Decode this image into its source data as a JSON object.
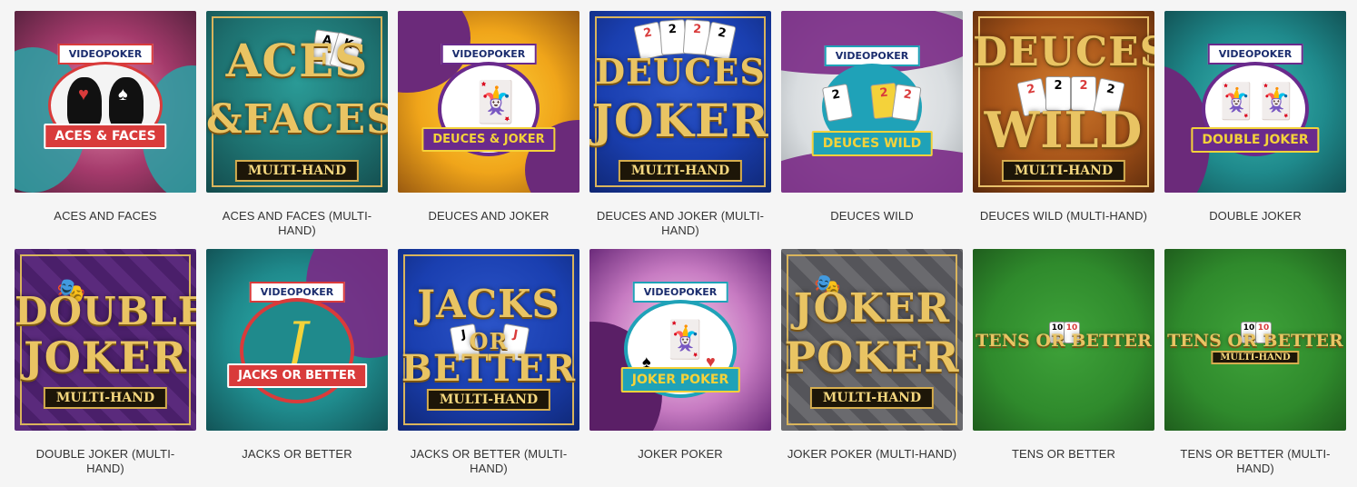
{
  "games": [
    {
      "title": "ACES AND FACES",
      "art": {
        "videopoker": "VIDEOPOKER",
        "ribbon": "ACES & FACES"
      }
    },
    {
      "title": "ACES AND FACES (MULTI-HAND)",
      "art": {
        "line1": "ACES",
        "line2": "&FACES",
        "band": "MULTI-HAND"
      }
    },
    {
      "title": "DEUCES AND JOKER",
      "art": {
        "videopoker": "VIDEOPOKER",
        "ribbon": "DEUCES & JOKER"
      }
    },
    {
      "title": "DEUCES AND JOKER (MULTI-HAND)",
      "art": {
        "line1": "DEUCES",
        "line2": "JOKER",
        "band": "MULTI-HAND"
      }
    },
    {
      "title": "DEUCES WILD",
      "art": {
        "videopoker": "VIDEOPOKER",
        "ribbon": "DEUCES WILD"
      }
    },
    {
      "title": "DEUCES WILD (MULTI-HAND)",
      "art": {
        "line1": "DEUCES",
        "line2": "WILD",
        "band": "MULTI-HAND"
      }
    },
    {
      "title": "DOUBLE JOKER",
      "art": {
        "videopoker": "VIDEOPOKER",
        "ribbon": "DOUBLE JOKER"
      }
    },
    {
      "title": "DOUBLE JOKER (MULTI-HAND)",
      "art": {
        "line1": "DOUBLE",
        "line2": "JOKER",
        "band": "MULTI-HAND"
      }
    },
    {
      "title": "JACKS OR BETTER",
      "art": {
        "videopoker": "VIDEOPOKER",
        "ribbon": "JACKS OR BETTER",
        "letter": "J"
      }
    },
    {
      "title": "JACKS OR BETTER (MULTI-HAND)",
      "art": {
        "line1": "JACKS",
        "line2": "OR",
        "line3": "BETTER",
        "band": "MULTI-HAND"
      }
    },
    {
      "title": "JOKER POKER",
      "art": {
        "videopoker": "VIDEOPOKER",
        "ribbon": "JOKER POKER"
      }
    },
    {
      "title": "JOKER POKER (MULTI-HAND)",
      "art": {
        "line1": "JOKER",
        "line2": "POKER",
        "band": "MULTI-HAND"
      }
    },
    {
      "title": "TENS OR BETTER",
      "art": {
        "line1": "TENS OR BETTER"
      }
    },
    {
      "title": "TENS OR BETTER (MULTI-HAND)",
      "art": {
        "line1": "TENS OR BETTER",
        "band": "MULTI-HAND"
      }
    }
  ],
  "colors": {
    "background": "#f5f5f5",
    "caption_text": "#333333",
    "gold_text": "#e9c463",
    "ribbon_red": "#d93b3b",
    "ribbon_purple": "#6a2a8c",
    "teal": "#1f8a8c",
    "royal_blue": "#1a3fb0",
    "felt_green": "#2f8a2c"
  }
}
